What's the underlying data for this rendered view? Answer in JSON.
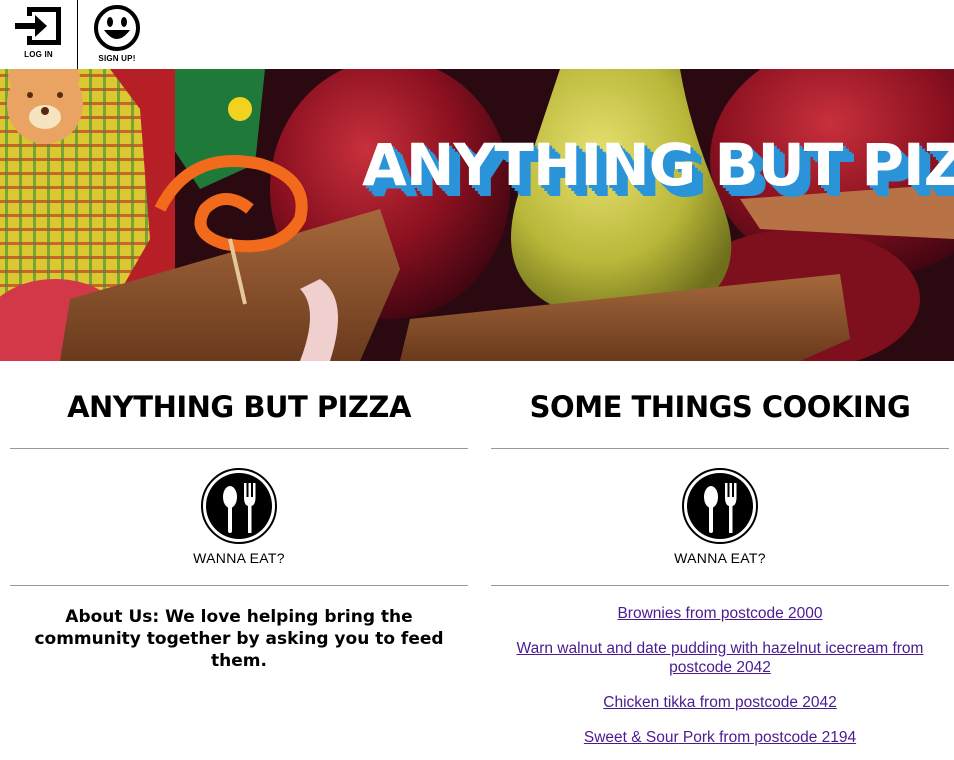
{
  "nav": {
    "login_label": "LOG IN",
    "signup_label": "SIGN UP!"
  },
  "hero": {
    "title": "ANYTHING BUT PIZZA"
  },
  "left": {
    "heading": "ANYTHING BUT PIZZA",
    "eat_label": "WANNA EAT?",
    "about": "About Us: We love helping bring the community together by asking you to feed them."
  },
  "right": {
    "heading": "SOME THINGS COOKING",
    "eat_label": "WANNA EAT?",
    "recipes": [
      "Brownies from postcode 2000",
      "Warn walnut and date pudding with hazelnut icecream from postcode 2042",
      "Chicken tikka from postcode 2042",
      "Sweet & Sour Pork from postcode 2194"
    ]
  },
  "colors": {
    "title_shadow": "#2b94d8",
    "link": "#4b1b8f"
  }
}
